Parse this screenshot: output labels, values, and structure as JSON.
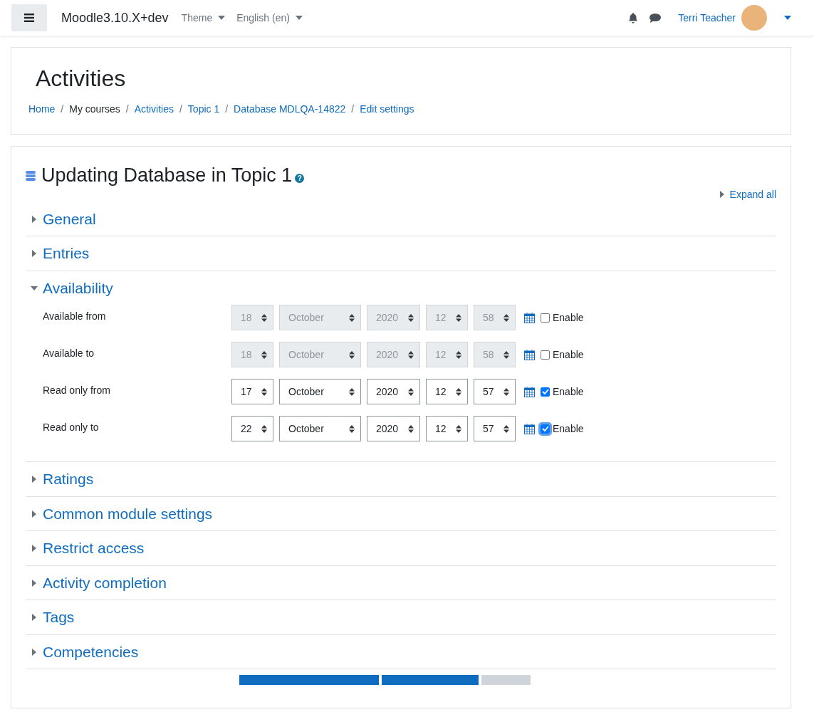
{
  "navbar": {
    "brand": "Moodle3.10.X+dev",
    "menus": [
      "Theme",
      "English (en)"
    ],
    "user": "Terri Teacher"
  },
  "header": {
    "title": "Activities",
    "separator": "/",
    "breadcrumbs": [
      {
        "label": "Home",
        "link": true
      },
      {
        "label": "My courses",
        "link": false
      },
      {
        "label": "Activities",
        "link": true
      },
      {
        "label": "Topic 1",
        "link": true
      },
      {
        "label": "Database MDLQA-14822",
        "link": true
      },
      {
        "label": "Edit settings",
        "link": true
      }
    ]
  },
  "form": {
    "title": "Updating Database in Topic 1",
    "help": "?",
    "expand_all": "Expand all",
    "sections": [
      {
        "label": "General",
        "expanded": false
      },
      {
        "label": "Entries",
        "expanded": false
      },
      {
        "label": "Availability",
        "expanded": true,
        "fields": [
          {
            "label": "Available from",
            "day": "18",
            "month": "October",
            "year": "2020",
            "hour": "12",
            "minute": "58",
            "enable_label": "Enable",
            "checked": false,
            "focused": false
          },
          {
            "label": "Available to",
            "day": "18",
            "month": "October",
            "year": "2020",
            "hour": "12",
            "minute": "58",
            "enable_label": "Enable",
            "checked": false,
            "focused": false
          },
          {
            "label": "Read only from",
            "day": "17",
            "month": "October",
            "year": "2020",
            "hour": "12",
            "minute": "57",
            "enable_label": "Enable",
            "checked": true,
            "focused": false
          },
          {
            "label": "Read only to",
            "day": "22",
            "month": "October",
            "year": "2020",
            "hour": "12",
            "minute": "57",
            "enable_label": "Enable",
            "checked": true,
            "focused": true
          }
        ]
      },
      {
        "label": "Ratings",
        "expanded": false
      },
      {
        "label": "Common module settings",
        "expanded": false
      },
      {
        "label": "Restrict access",
        "expanded": false
      },
      {
        "label": "Activity completion",
        "expanded": false
      },
      {
        "label": "Tags",
        "expanded": false
      },
      {
        "label": "Competencies",
        "expanded": false
      }
    ],
    "buttons": [
      {
        "kind": "primary"
      },
      {
        "kind": "primary"
      },
      {
        "kind": "secondary"
      }
    ]
  }
}
